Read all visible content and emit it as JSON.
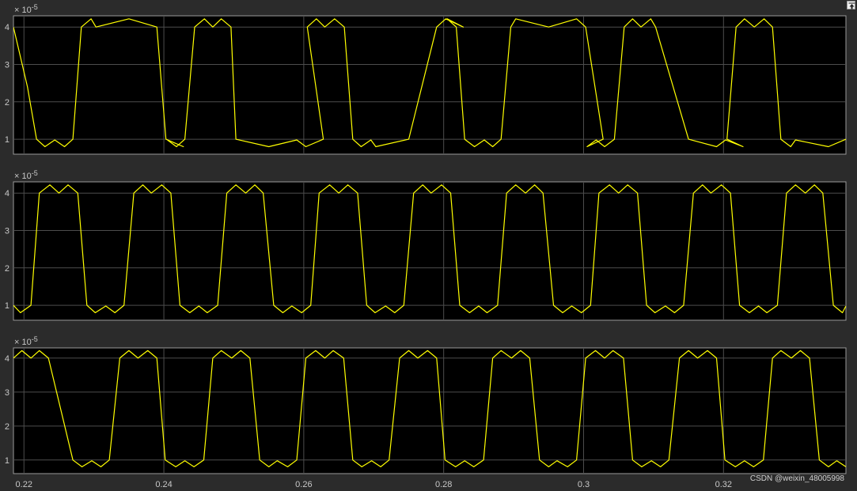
{
  "window": {
    "restore_icon": "undock-arrow-icon",
    "watermark": "CSDN @weixin_48005998"
  },
  "style": {
    "background": "#2b2b2b",
    "axes_background": "#000000",
    "axes_border": "#9a9a9a",
    "grid_color": "#4d4d4d",
    "text_color": "#c8c8c8",
    "line_color": "#ffff00"
  },
  "chart_data": [
    {
      "type": "line",
      "exponent_label": "× 10^-5",
      "xlim": [
        0.2185,
        0.3375
      ],
      "ylim": [
        0.6,
        4.3
      ],
      "y_ticks": [
        1,
        2,
        3,
        4
      ],
      "grid": true,
      "x_tick_labels_shown": false,
      "series": [
        {
          "x": [
            0.2185,
            0.2205,
            0.2218,
            0.223,
            0.2244,
            0.2258,
            0.227,
            0.2282,
            0.2296,
            0.2303,
            0.235,
            0.239,
            0.2403,
            0.2428,
            0.2405,
            0.2418,
            0.243,
            0.2444,
            0.2458,
            0.247,
            0.2482,
            0.2496,
            0.2503,
            0.255,
            0.259,
            0.2603,
            0.2628,
            0.2605,
            0.2618,
            0.263,
            0.2644,
            0.2658,
            0.267,
            0.2682,
            0.2696,
            0.2703,
            0.275,
            0.279,
            0.2803,
            0.2828,
            0.2805,
            0.2818,
            0.283,
            0.2844,
            0.2858,
            0.287,
            0.2882,
            0.2896,
            0.2903,
            0.295,
            0.299,
            0.3003,
            0.3028,
            0.3005,
            0.3018,
            0.303,
            0.3044,
            0.3058,
            0.307,
            0.3082,
            0.3096,
            0.3103,
            0.315,
            0.319,
            0.3203,
            0.3228,
            0.3205,
            0.3218,
            0.323,
            0.3244,
            0.3258,
            0.327,
            0.3282,
            0.3296,
            0.3303,
            0.335,
            0.3375
          ],
          "y": [
            4.0,
            2.4,
            1.0,
            0.8,
            0.98,
            0.8,
            1.0,
            4.0,
            4.22,
            4.0,
            4.22,
            4.0,
            1.0,
            0.8,
            0.98,
            0.8,
            1.0,
            4.0,
            4.22,
            4.0,
            4.22,
            4.0,
            1.0,
            0.8,
            0.98,
            0.8,
            1.0,
            4.0,
            4.22,
            4.0,
            4.22,
            4.0,
            1.0,
            0.8,
            0.98,
            0.8,
            1.0,
            4.0,
            4.22,
            4.0,
            4.22,
            4.0,
            1.0,
            0.8,
            0.98,
            0.8,
            1.0,
            4.0,
            4.22,
            4.0,
            4.22,
            4.0,
            1.0,
            0.8,
            0.98,
            0.8,
            1.0,
            4.0,
            4.22,
            4.0,
            4.22,
            4.0,
            1.0,
            0.8,
            0.98,
            0.8,
            1.0,
            4.0,
            4.22,
            4.0,
            4.22,
            4.0,
            1.0,
            0.8,
            0.98,
            0.8,
            1.0
          ]
        }
      ]
    },
    {
      "type": "line",
      "exponent_label": "× 10^-5",
      "xlim": [
        0.2185,
        0.3375
      ],
      "ylim": [
        0.6,
        4.3
      ],
      "y_ticks": [
        1,
        2,
        3,
        4
      ],
      "grid": true,
      "x_tick_labels_shown": false,
      "series": [
        {
          "x": [
            0.2185,
            0.2195,
            0.221,
            0.2222,
            0.2237,
            0.225,
            0.2263,
            0.2277,
            0.229,
            0.2302,
            0.2317,
            0.233,
            0.2343,
            0.2357,
            0.237,
            0.2382,
            0.2397,
            0.241,
            0.2423,
            0.2437,
            0.245,
            0.2462,
            0.2477,
            0.249,
            0.2503,
            0.2517,
            0.253,
            0.2542,
            0.2557,
            0.257,
            0.2583,
            0.2597,
            0.261,
            0.2622,
            0.2637,
            0.265,
            0.2663,
            0.2677,
            0.269,
            0.2702,
            0.2717,
            0.273,
            0.2743,
            0.2757,
            0.277,
            0.2782,
            0.2797,
            0.281,
            0.2823,
            0.2837,
            0.285,
            0.2862,
            0.2877,
            0.289,
            0.2903,
            0.2917,
            0.293,
            0.2942,
            0.2957,
            0.297,
            0.2983,
            0.2997,
            0.301,
            0.3022,
            0.3037,
            0.305,
            0.3063,
            0.3077,
            0.309,
            0.3102,
            0.3117,
            0.313,
            0.3143,
            0.3157,
            0.317,
            0.3182,
            0.3197,
            0.321,
            0.3223,
            0.3237,
            0.325,
            0.3262,
            0.3277,
            0.329,
            0.3303,
            0.3317,
            0.333,
            0.3342,
            0.3357,
            0.337,
            0.3375
          ],
          "y": [
            1.0,
            0.8,
            1.0,
            4.0,
            4.22,
            4.0,
            4.22,
            4.0,
            1.0,
            0.8,
            0.98,
            0.8,
            1.0,
            4.0,
            4.22,
            4.0,
            4.22,
            4.0,
            1.0,
            0.8,
            0.98,
            0.8,
            1.0,
            4.0,
            4.22,
            4.0,
            4.22,
            4.0,
            1.0,
            0.8,
            0.98,
            0.8,
            1.0,
            4.0,
            4.22,
            4.0,
            4.22,
            4.0,
            1.0,
            0.8,
            0.98,
            0.8,
            1.0,
            4.0,
            4.22,
            4.0,
            4.22,
            4.0,
            1.0,
            0.8,
            0.98,
            0.8,
            1.0,
            4.0,
            4.22,
            4.0,
            4.22,
            4.0,
            1.0,
            0.8,
            0.98,
            0.8,
            1.0,
            4.0,
            4.22,
            4.0,
            4.22,
            4.0,
            1.0,
            0.8,
            0.98,
            0.8,
            1.0,
            4.0,
            4.22,
            4.0,
            4.22,
            4.0,
            1.0,
            0.8,
            0.98,
            0.8,
            1.0,
            4.0,
            4.22,
            4.0,
            4.22,
            4.0,
            1.0,
            0.8,
            0.98
          ]
        }
      ]
    },
    {
      "type": "line",
      "exponent_label": "× 10^-5",
      "xlim": [
        0.2185,
        0.3375
      ],
      "ylim": [
        0.6,
        4.3
      ],
      "y_ticks": [
        1,
        2,
        3,
        4
      ],
      "x_ticks": [
        0.22,
        0.24,
        0.26,
        0.28,
        0.3,
        0.32
      ],
      "x_tick_labels": [
        "0.22",
        "0.24",
        "0.26",
        "0.28",
        "0.3",
        "0.32"
      ],
      "grid": true,
      "x_tick_labels_shown": true,
      "series": [
        {
          "x": [
            0.2185,
            0.2197,
            0.221,
            0.2222,
            0.2235,
            0.227,
            0.2283,
            0.2297,
            0.231,
            0.2322,
            0.2337,
            0.235,
            0.2363,
            0.2377,
            0.239,
            0.2402,
            0.2417,
            0.243,
            0.2443,
            0.2457,
            0.247,
            0.2482,
            0.2497,
            0.251,
            0.2523,
            0.2537,
            0.255,
            0.2562,
            0.2577,
            0.259,
            0.2603,
            0.2617,
            0.263,
            0.2642,
            0.2657,
            0.267,
            0.2683,
            0.2697,
            0.271,
            0.2722,
            0.2737,
            0.275,
            0.2763,
            0.2777,
            0.279,
            0.2802,
            0.2817,
            0.283,
            0.2843,
            0.2857,
            0.287,
            0.2882,
            0.2897,
            0.291,
            0.2923,
            0.2937,
            0.295,
            0.2962,
            0.2977,
            0.299,
            0.3003,
            0.3017,
            0.303,
            0.3042,
            0.3057,
            0.307,
            0.3083,
            0.3097,
            0.311,
            0.3122,
            0.3137,
            0.315,
            0.3163,
            0.3177,
            0.319,
            0.3202,
            0.3217,
            0.323,
            0.3243,
            0.3257,
            0.327,
            0.3282,
            0.3297,
            0.331,
            0.3323,
            0.3337,
            0.335,
            0.3362,
            0.3375
          ],
          "y": [
            4.0,
            4.22,
            4.0,
            4.22,
            4.0,
            1.0,
            0.8,
            0.98,
            0.8,
            1.0,
            4.0,
            4.22,
            4.0,
            4.22,
            4.0,
            1.0,
            0.8,
            0.98,
            0.8,
            1.0,
            4.0,
            4.22,
            4.0,
            4.22,
            4.0,
            1.0,
            0.8,
            0.98,
            0.8,
            1.0,
            4.0,
            4.22,
            4.0,
            4.22,
            4.0,
            1.0,
            0.8,
            0.98,
            0.8,
            1.0,
            4.0,
            4.22,
            4.0,
            4.22,
            4.0,
            1.0,
            0.8,
            0.98,
            0.8,
            1.0,
            4.0,
            4.22,
            4.0,
            4.22,
            4.0,
            1.0,
            0.8,
            0.98,
            0.8,
            1.0,
            4.0,
            4.22,
            4.0,
            4.22,
            4.0,
            1.0,
            0.8,
            0.98,
            0.8,
            1.0,
            4.0,
            4.22,
            4.0,
            4.22,
            4.0,
            1.0,
            0.8,
            0.98,
            0.8,
            1.0,
            4.0,
            4.22,
            4.0,
            4.22,
            4.0,
            1.0,
            0.8,
            0.98,
            0.8
          ]
        }
      ]
    }
  ]
}
